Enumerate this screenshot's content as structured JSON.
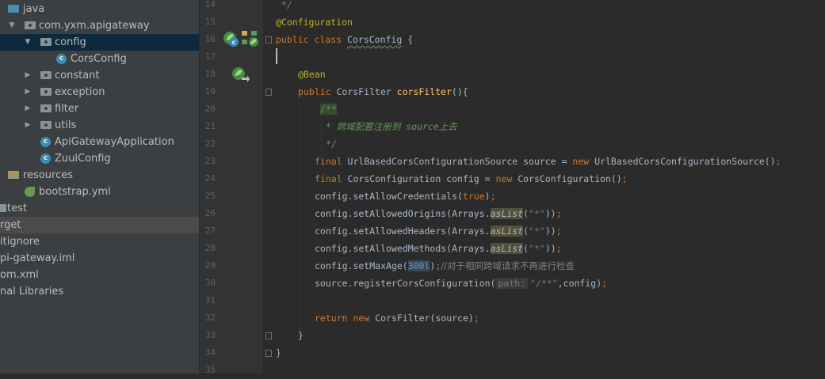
{
  "project_tree": [
    {
      "label": "java",
      "icon": "source-folder-icon",
      "expand": "",
      "selected": false,
      "highlight": false
    },
    {
      "label": "com.yxm.apigateway",
      "icon": "package-icon",
      "expand": "▼",
      "selected": false,
      "highlight": false
    },
    {
      "label": "config",
      "icon": "package-icon",
      "expand": "▼",
      "selected": true,
      "highlight": false
    },
    {
      "label": "CorsConfig",
      "icon": "class-icon",
      "expand": "",
      "selected": false,
      "highlight": false
    },
    {
      "label": "constant",
      "icon": "package-icon",
      "expand": "▶",
      "selected": false,
      "highlight": false
    },
    {
      "label": "exception",
      "icon": "package-icon",
      "expand": "▶",
      "selected": false,
      "highlight": false
    },
    {
      "label": "filter",
      "icon": "package-icon",
      "expand": "▶",
      "selected": false,
      "highlight": false
    },
    {
      "label": "utils",
      "icon": "package-icon",
      "expand": "▶",
      "selected": false,
      "highlight": false
    },
    {
      "label": "ApiGatewayApplication",
      "icon": "spring-class-icon",
      "expand": "",
      "selected": false,
      "highlight": false
    },
    {
      "label": "ZuulConfig",
      "icon": "class-icon",
      "expand": "",
      "selected": false,
      "highlight": false
    },
    {
      "label": "resources",
      "icon": "resources-folder-icon",
      "expand": "",
      "selected": false,
      "highlight": false
    },
    {
      "label": "bootstrap.yml",
      "icon": "yaml-file-icon",
      "expand": "",
      "selected": false,
      "highlight": false
    },
    {
      "label": "test",
      "icon": "folder-icon",
      "expand": "",
      "selected": false,
      "highlight": false
    },
    {
      "label": "rget",
      "icon": "folder-icon",
      "expand": "",
      "selected": false,
      "highlight": true
    },
    {
      "label": "itignore",
      "icon": "file-icon",
      "expand": "",
      "selected": false,
      "highlight": false
    },
    {
      "label": "pi-gateway.iml",
      "icon": "file-icon",
      "expand": "",
      "selected": false,
      "highlight": false
    },
    {
      "label": "om.xml",
      "icon": "file-icon",
      "expand": "",
      "selected": false,
      "highlight": false
    },
    {
      "label": "nal Libraries",
      "icon": "libraries-icon",
      "expand": "",
      "selected": false,
      "highlight": false
    }
  ],
  "line_numbers": [
    "14",
    "15",
    "16",
    "17",
    "18",
    "19",
    "20",
    "21",
    "22",
    "23",
    "24",
    "25",
    "26",
    "27",
    "28",
    "29",
    "30",
    "31",
    "32",
    "33",
    "34",
    "35"
  ],
  "code": {
    "l14": " */",
    "l15_ann": "@Configuration",
    "l16_kw1": "public",
    "l16_kw2": "class",
    "l16_name": "CorsConfig",
    "l16_rest": " {",
    "l18_ann": "@Bean",
    "l19_kw": "public",
    "l19_type": " CorsFilter ",
    "l19_fn": "corsFilter",
    "l19_rest": "(){",
    "l20": "/**",
    "l21_star": " * ",
    "l21_cjk1": "跨域配置注册到",
    "l21_code": " source",
    "l21_cjk2": "上去",
    "l22": " */",
    "l23_kw": "final",
    "l23_a": " UrlBasedCorsConfigurationSource source = ",
    "l23_new": "new",
    "l23_b": " UrlBasedCorsConfigurationSource()",
    "l23_semi": ";",
    "l24_kw": "final",
    "l24_a": " CorsConfiguration config = ",
    "l24_new": "new",
    "l24_b": " CorsConfiguration()",
    "l24_semi": ";",
    "l25_a": "config.setAllowCredentials(",
    "l25_true": "true",
    "l25_b": ")",
    "l25_semi": ";",
    "l26_a": "config.setAllowedOrigins(Arrays.",
    "l26_m": "asList",
    "l26_b": "(",
    "l26_s": "\"*\"",
    "l26_c": "))",
    "l26_semi": ";",
    "l27_a": "config.setAllowedHeaders(Arrays.",
    "l27_m": "asList",
    "l27_b": "(",
    "l27_s": "\"*\"",
    "l27_c": "))",
    "l27_semi": ";",
    "l28_a": "config.setAllowedMethods(Arrays.",
    "l28_m": "asList",
    "l28_b": "(",
    "l28_s": "\"*\"",
    "l28_c": "))",
    "l28_semi": ";",
    "l29_a": "config.setMaxAge(",
    "l29_num": "300l",
    "l29_b": ")",
    "l29_semi": ";",
    "l29_cm": "//对于相同跨域请求不再进行检查",
    "l30_a": "source.registerCorsConfiguration(",
    "l30_hint": "path:",
    "l30_s": "\"/**\"",
    "l30_b": ",config)",
    "l30_semi": ";",
    "l32_kw1": "return",
    "l32_kw2": "new",
    "l32_rest": " CorsFilter(source)",
    "l32_semi": ";",
    "l33": "}",
    "l34": "}"
  },
  "gutter_icons": [
    "spring-bean-class-icon",
    "spring-config-icon",
    "spring-bean-method-icon"
  ],
  "colors": {
    "keyword": "#cc7832",
    "annotation": "#bbb529",
    "method": "#ffc66d",
    "doc_comment": "#629755",
    "string": "#6a8759",
    "number": "#6897bb",
    "text": "#a9b7c6"
  }
}
